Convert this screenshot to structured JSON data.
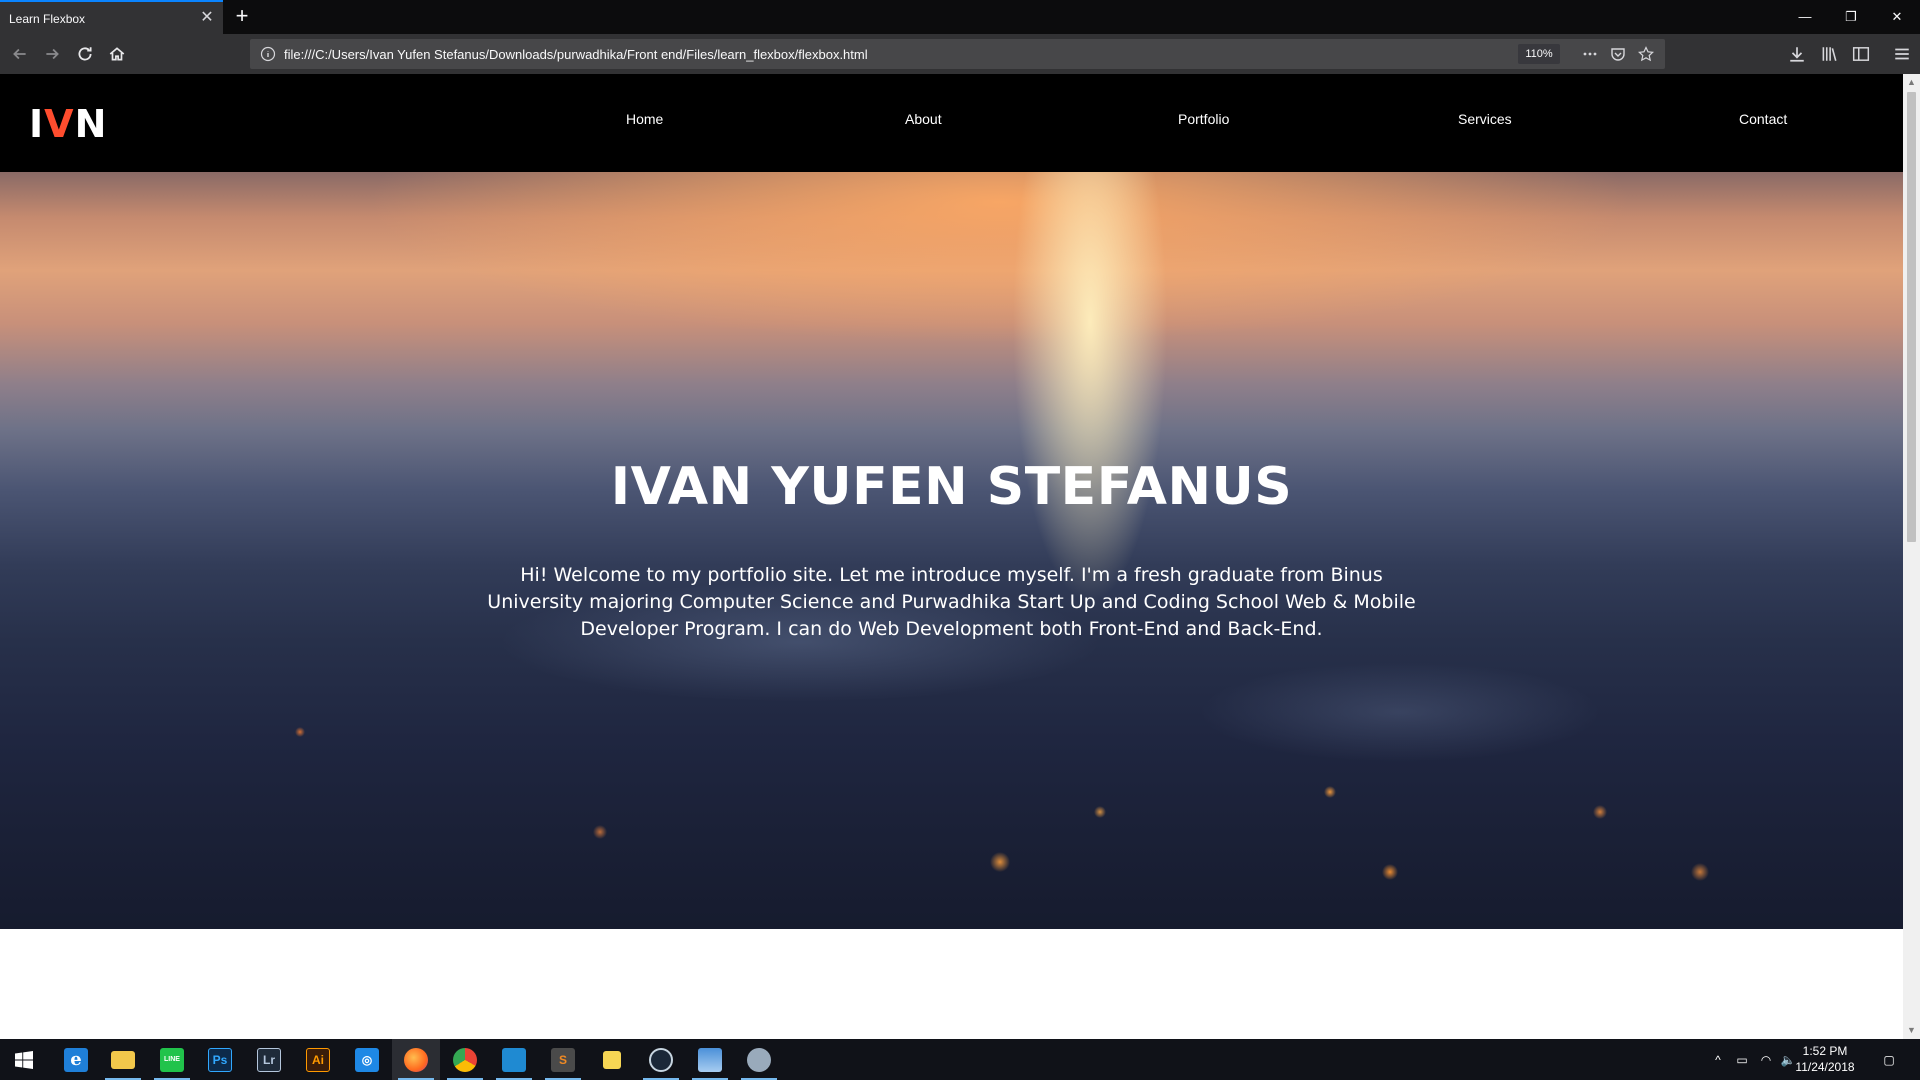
{
  "browser": {
    "tab_title": "Learn Flexbox",
    "tab_close": "✕",
    "new_tab": "+",
    "url": "file:///C:/Users/Ivan Yufen Stefanus/Downloads/purwadhika/Front end/Files/learn_flexbox/flexbox.html",
    "zoom": "110%",
    "window_controls": {
      "minimize": "—",
      "restore": "❐",
      "close": "✕"
    }
  },
  "site": {
    "logo_left": "I",
    "logo_accent": "V",
    "logo_right": "N",
    "accent_color": "#ff4d2e",
    "nav": [
      "Home",
      "About",
      "Portfolio",
      "Services",
      "Contact"
    ],
    "hero_title": "IVAN YUFEN STEFANUS",
    "hero_text": "Hi! Welcome to my portfolio site. Let me introduce myself. I'm a fresh graduate from Binus University majoring Computer Science and Purwadhika Start Up and Coding School Web & Mobile Developer Program. I can do Web Development both Front-End and Back-End."
  },
  "taskbar": {
    "apps": [
      {
        "icon": "windows-start-icon",
        "label": "",
        "color": "#ffffff"
      },
      {
        "icon": "edge-icon",
        "label": "e",
        "color": "#1f7fd8"
      },
      {
        "icon": "file-explorer-icon",
        "label": "",
        "color": "#f2c84b"
      },
      {
        "icon": "line-icon",
        "label": "LINE",
        "color": "#21c34b"
      },
      {
        "icon": "photoshop-icon",
        "label": "Ps",
        "color": "#0d2a4a"
      },
      {
        "icon": "lightroom-icon",
        "label": "Lr",
        "color": "#1f2b3a"
      },
      {
        "icon": "illustrator-icon",
        "label": "Ai",
        "color": "#3a1d0a"
      },
      {
        "icon": "app-icon",
        "label": "◎",
        "color": "#1e88e5"
      },
      {
        "icon": "firefox-icon",
        "label": "",
        "color": "#ff6a1f"
      },
      {
        "icon": "chrome-icon",
        "label": "",
        "color": "#34a853"
      },
      {
        "icon": "vscode-icon",
        "label": "",
        "color": "#1f8ad2"
      },
      {
        "icon": "sublime-icon",
        "label": "S",
        "color": "#f08a24"
      },
      {
        "icon": "sticky-notes-icon",
        "label": "",
        "color": "#f6d654"
      },
      {
        "icon": "steam-icon",
        "label": "",
        "color": "#1b2838"
      },
      {
        "icon": "window-app-icon",
        "label": "",
        "color": "#4a90d9"
      },
      {
        "icon": "paint-icon",
        "label": "",
        "color": "#9ab"
      }
    ],
    "time": "1:52 PM",
    "date": "11/24/2018"
  }
}
